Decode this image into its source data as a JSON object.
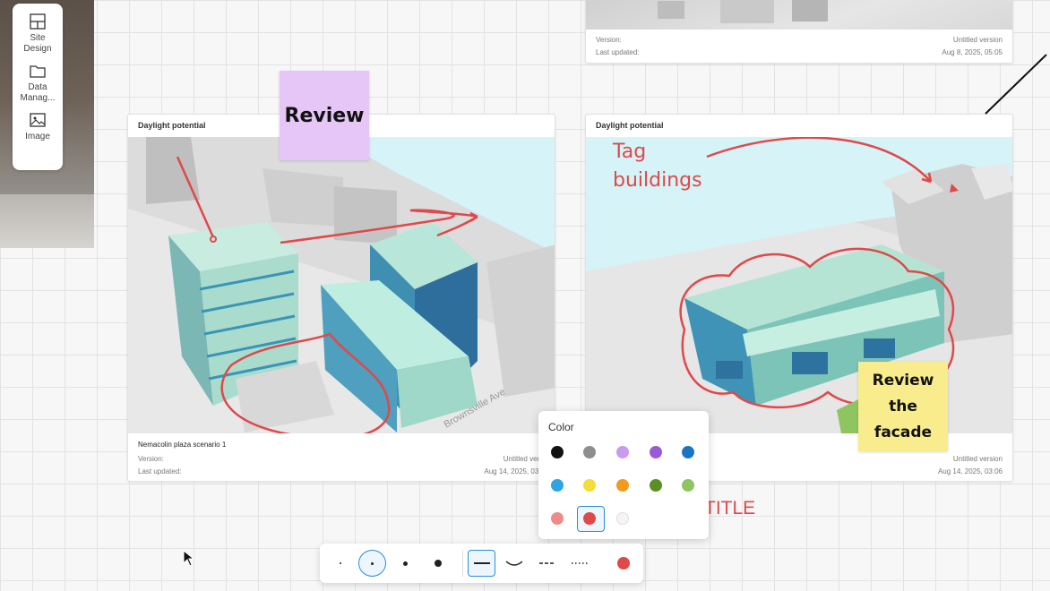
{
  "toolbox": {
    "items": [
      {
        "label": "Site\nDesign",
        "icon": "site-design-icon"
      },
      {
        "label": "Data\nManag...",
        "icon": "folder-icon"
      },
      {
        "label": "Image",
        "icon": "image-icon"
      }
    ]
  },
  "cards": {
    "top_right": {
      "version_label": "Version:",
      "version_value": "Untitled version",
      "updated_label": "Last updated:",
      "updated_value": "Aug 8, 2025, 05:05"
    },
    "left": {
      "title": "Daylight potential",
      "name": "Nemacolin plaza scenario 1",
      "version_label": "Version:",
      "version_value": "Untitled versi",
      "updated_label": "Last updated:",
      "updated_value": "Aug 14, 2025, 03:0"
    },
    "right": {
      "title": "Daylight potential",
      "version_value": "Untitled version",
      "updated_value": "Aug 14, 2025, 03:06"
    }
  },
  "notes": {
    "review": "Review",
    "review_facade": "Review\nthe\nfacade"
  },
  "annotations": {
    "tag_buildings": "Tag\nbuildings",
    "title_fragment": "TITLE",
    "map_label_street": "Brownsville Ave"
  },
  "color_popup": {
    "title": "Color",
    "swatches": [
      "#111111",
      "#8e8e8e",
      "#c89af0",
      "#9b59d9",
      "#1a74c4",
      "#2fa3e3",
      "#f5dc3b",
      "#f29a1a",
      "#5c8f23",
      "#8fc561",
      "#f08a8a",
      "#e0484a",
      "#f5f5f5"
    ],
    "selected": "#e0484a"
  },
  "bottom_bar": {
    "stroke_sizes": [
      "size-1",
      "size-2",
      "size-3",
      "size-4"
    ],
    "selected_size": "size-2",
    "line_styles": [
      "solid",
      "curve",
      "dashed",
      "dotted"
    ],
    "selected_style": "solid",
    "current_color": "#e0484a"
  }
}
